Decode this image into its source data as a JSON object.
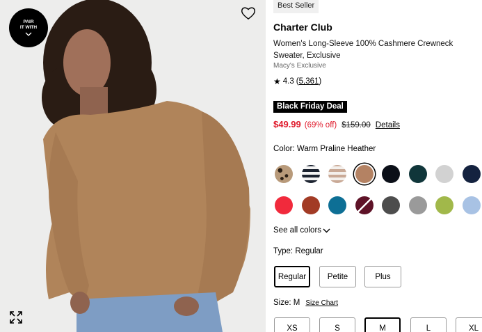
{
  "image": {
    "pair_badge": {
      "line1": "PAIR",
      "line2": "IT WITH"
    }
  },
  "product": {
    "badge": "Best Seller",
    "brand": "Charter Club",
    "title": "Women's Long-Sleeve 100% Cashmere Crewneck Sweater, Exclusive",
    "exclusive": "Macy's Exclusive",
    "rating": "4.3",
    "review_count": "5,361",
    "deal_label": "Black Friday Deal",
    "sale_price": "$49.99",
    "discount": "(69% off)",
    "original_price": "$159.00",
    "details_link": "Details",
    "color_prefix": "Color:",
    "color_name": "Warm Praline Heather",
    "swatch_colors": [
      "#6b5340",
      "#1c2330",
      "#d9c8bb",
      "#b48263",
      "#0b0f18",
      "#10363a",
      "#d2d2d2",
      "#14223f",
      "#f12a3c",
      "#a23b25",
      "#0d6f95",
      "#5e1227",
      "#4d4d4d",
      "#9a9a9a",
      "#a1b84a",
      "#a8c2e4"
    ],
    "selected_swatch": 3,
    "see_all_colors": "See all colors",
    "type_prefix": "Type:",
    "type_value": "Regular",
    "types": [
      "Regular",
      "Petite",
      "Plus"
    ],
    "size_prefix": "Size:",
    "size_value": "M",
    "size_chart": "Size Chart",
    "sizes": [
      "XS",
      "S",
      "M",
      "L",
      "XL"
    ]
  }
}
